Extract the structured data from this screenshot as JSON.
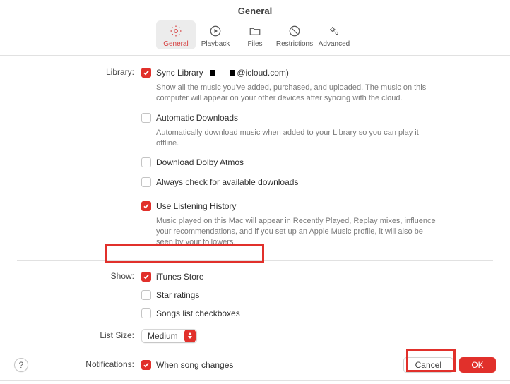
{
  "title": "General",
  "tabs": [
    {
      "label": "General"
    },
    {
      "label": "Playback"
    },
    {
      "label": "Files"
    },
    {
      "label": "Restrictions"
    },
    {
      "label": "Advanced"
    }
  ],
  "labels": {
    "library": "Library:",
    "show": "Show:",
    "listSize": "List Size:",
    "notifications": "Notifications:"
  },
  "library": {
    "sync": {
      "checked": true,
      "label": "Sync Library",
      "account_suffix": "@icloud.com)",
      "desc": "Show all the music you've added, purchased, and uploaded. The music on this computer will appear on your other devices after syncing with the cloud."
    },
    "auto": {
      "checked": false,
      "label": "Automatic Downloads",
      "desc": "Automatically download music when added to your Library so you can play it offline."
    },
    "dolby": {
      "checked": false,
      "label": "Download Dolby Atmos"
    },
    "checkDl": {
      "checked": false,
      "label": "Always check for available downloads"
    },
    "history": {
      "checked": true,
      "label": "Use Listening History",
      "desc": "Music played on this Mac will appear in Recently Played, Replay mixes, influence your recommendations, and if you set up an Apple Music profile, it will also be seen by your followers."
    }
  },
  "show": {
    "itunes": {
      "checked": true,
      "label": "iTunes Store"
    },
    "stars": {
      "checked": false,
      "label": "Star ratings"
    },
    "songcb": {
      "checked": false,
      "label": "Songs list checkboxes"
    }
  },
  "listSize": {
    "value": "Medium"
  },
  "notifications": {
    "songChanges": {
      "checked": true,
      "label": "When song changes"
    }
  },
  "buttons": {
    "cancel": "Cancel",
    "ok": "OK"
  },
  "help": "?"
}
